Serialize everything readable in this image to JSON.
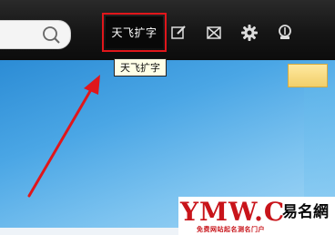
{
  "toolbar": {
    "search_icon": "search-icon",
    "feature_button_label": "天飞扩字",
    "tools": [
      {
        "name": "edit-icon"
      },
      {
        "name": "mail-icon"
      },
      {
        "name": "gear-icon"
      },
      {
        "name": "skin-icon"
      }
    ]
  },
  "tooltip": {
    "text": "天飞扩字"
  },
  "colors": {
    "highlight": "#e0161b",
    "arrow": "#e0161b",
    "toolbar_bg": "#151515",
    "desktop": "#4aa6e5"
  },
  "watermark": {
    "brand": "易名網",
    "domain": "YMW.CN",
    "sub": "免费网站起名测名门户"
  }
}
